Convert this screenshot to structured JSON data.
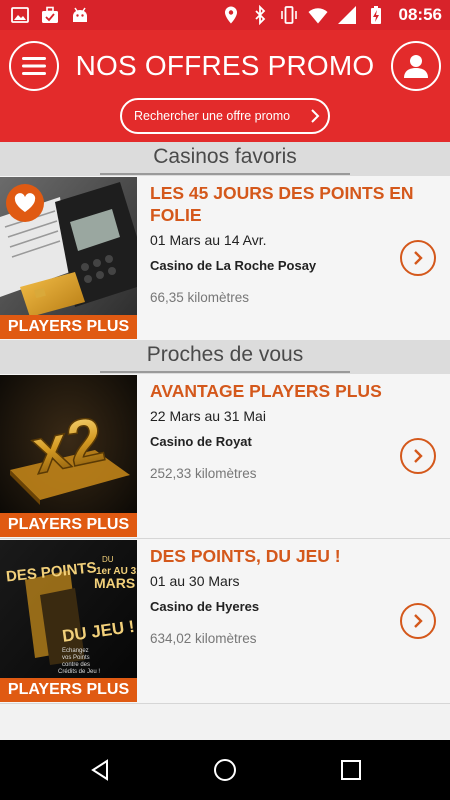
{
  "status_bar": {
    "time": "08:56",
    "left_icons": [
      "image-icon",
      "briefcase-icon",
      "android-icon"
    ],
    "right_icons": [
      "location-icon",
      "bluetooth-icon",
      "vibrate-icon",
      "wifi-icon",
      "signal-icon",
      "battery-icon"
    ]
  },
  "header": {
    "title": "NOS OFFRES PROMO",
    "search_label": "Rechercher une offre promo",
    "menu_icon": "hamburger-menu-icon",
    "user_icon": "user-icon"
  },
  "sections": [
    {
      "label": "Casinos favoris"
    },
    {
      "label": "Proches de vous"
    }
  ],
  "promos": [
    {
      "title": "LES 45 JOURS DES POINTS EN FOLIE",
      "dates": "01 Mars au 14 Avr.",
      "casino": "Casino de La Roche Posay",
      "distance": "66,35 kilomètres",
      "badge": "PLAYERS PLUS",
      "favorite": true
    },
    {
      "title": "AVANTAGE PLAYERS PLUS",
      "dates": "22 Mars au 31 Mai",
      "casino": "Casino de Royat",
      "distance": "252,33 kilomètres",
      "badge": "PLAYERS PLUS",
      "thumb_text": "x2"
    },
    {
      "title": "DES POINTS, DU JEU !",
      "dates": "01 au 30 Mars",
      "casino": "Casino de Hyeres",
      "distance": "634,02 kilomètres",
      "badge": "PLAYERS PLUS",
      "thumb_text": {
        "line1": "DES POINTS",
        "line2": "DU JEU !",
        "date_du": "DU",
        "date_range": "1er AU 31",
        "date_month": "MARS",
        "small_1": "Echangez",
        "small_2": "vos Points",
        "small_3": "contre des",
        "small_4": "Crédits de Jeu !"
      }
    }
  ],
  "colors": {
    "brand_red": "#e32b2b",
    "status_red": "#d8232a",
    "accent_orange": "#d4581b",
    "badge_orange": "#e05a12"
  },
  "nav_bar": {
    "back_icon": "back-triangle-icon",
    "home_icon": "home-circle-icon",
    "recents_icon": "recents-square-icon"
  }
}
